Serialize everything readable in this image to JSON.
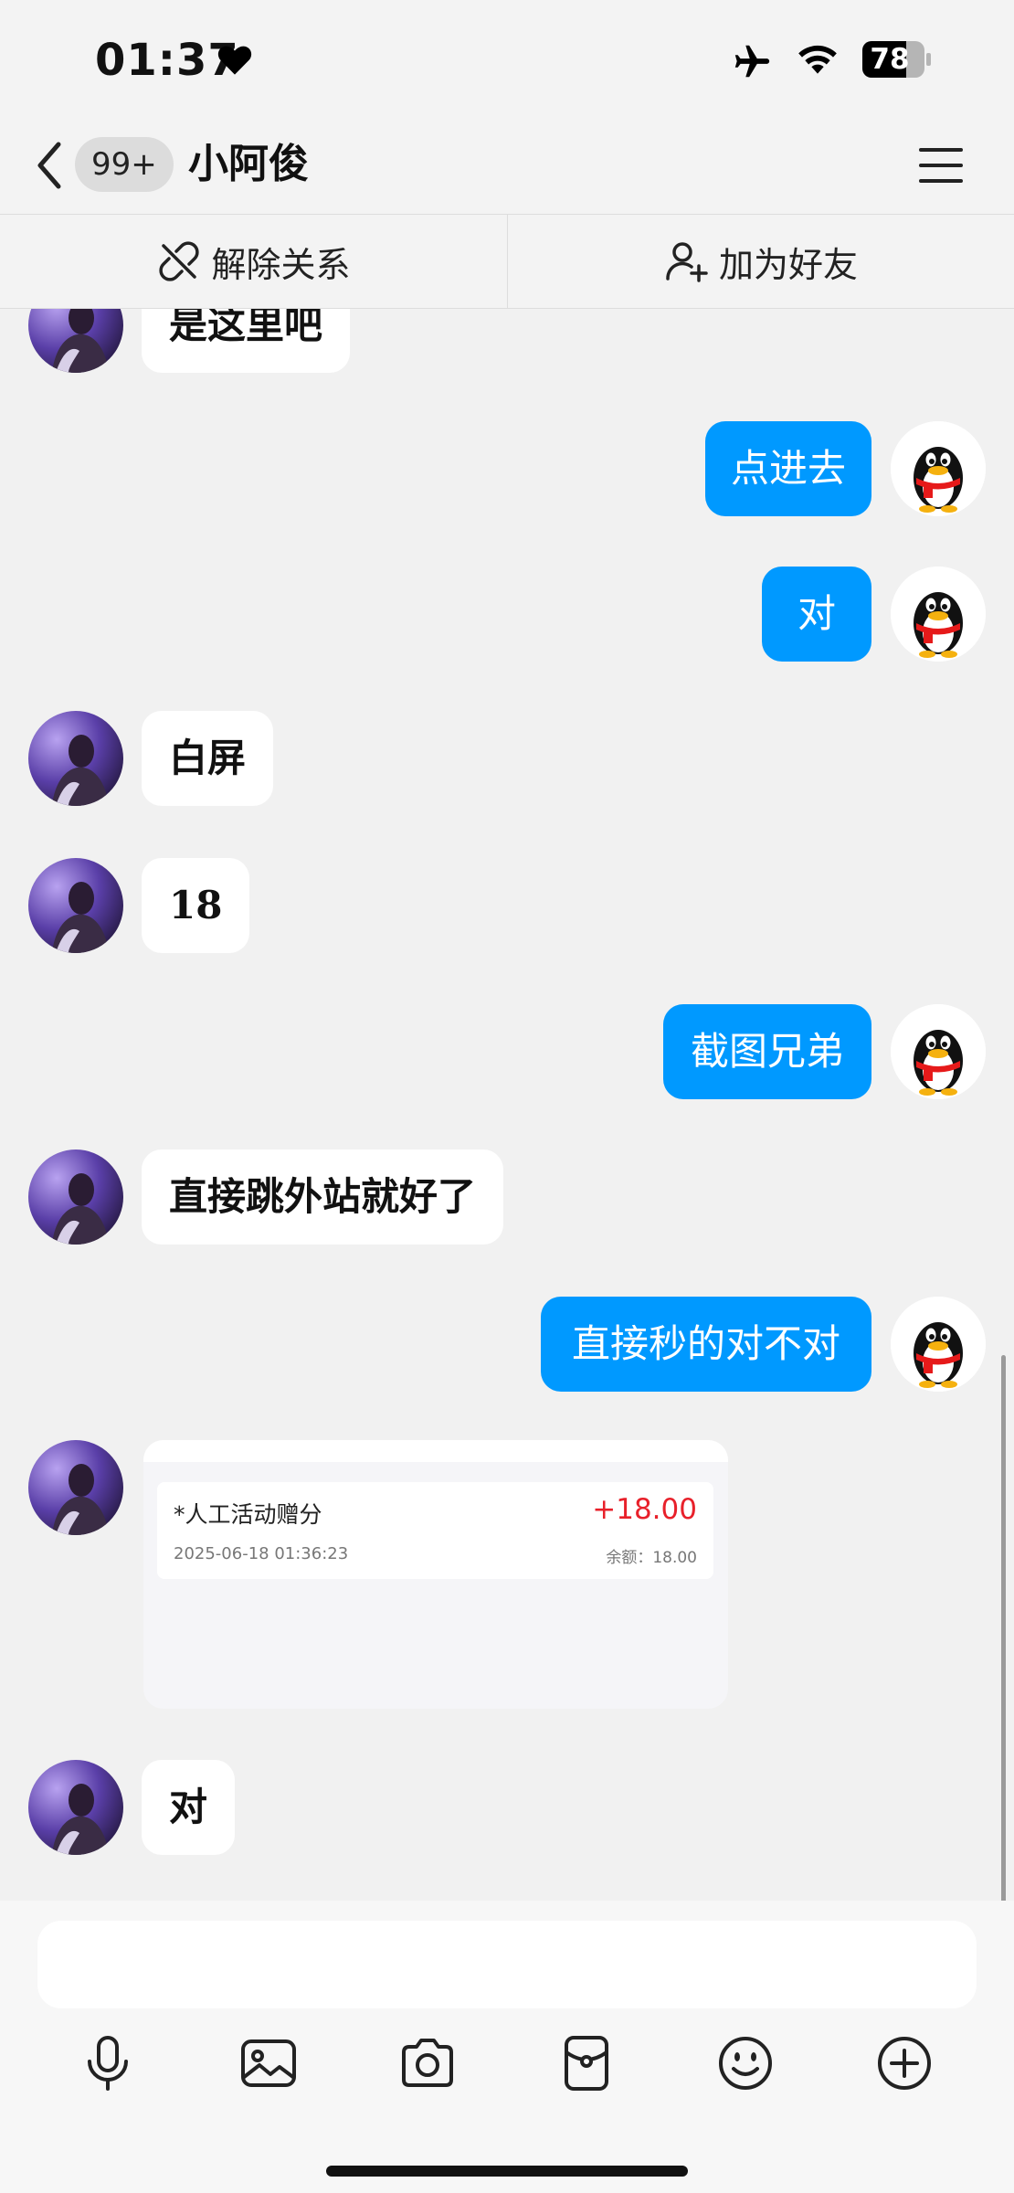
{
  "status_bar": {
    "time": "01:37",
    "battery": "78",
    "icons": [
      "heart-icon",
      "airplane-icon",
      "wifi-icon",
      "battery-icon"
    ]
  },
  "nav": {
    "unread_count": "99+",
    "title": "小阿俊",
    "icons": [
      "chevron-left-icon",
      "menu-icon"
    ]
  },
  "actions": {
    "unlink_label": "解除关系",
    "add_friend_label": "加为好友"
  },
  "messages": [
    {
      "side": "in",
      "text": "是这里吧"
    },
    {
      "side": "out",
      "text": "点进去"
    },
    {
      "side": "out",
      "text": "对"
    },
    {
      "side": "in",
      "text": "白屏"
    },
    {
      "side": "in",
      "text": "18"
    },
    {
      "side": "out",
      "text": "截图兄弟"
    },
    {
      "side": "in",
      "text": "直接跳外站就好了"
    },
    {
      "side": "out",
      "text": "直接秒的对不对"
    },
    {
      "side": "in",
      "type": "image"
    },
    {
      "side": "in",
      "text": "对"
    }
  ],
  "screenshot_card": {
    "item_name": "*人工活动赠分",
    "item_date": "2025-06-18 01:36:23",
    "amount": "+18.00",
    "balance": "余额：18.00"
  },
  "input": {
    "placeholder": "",
    "value": ""
  },
  "toolbar": {
    "icons": [
      "microphone-icon",
      "image-icon",
      "camera-icon",
      "red-packet-icon",
      "emoji-icon",
      "plus-icon"
    ]
  },
  "colors": {
    "accent_blue": "#0099ff",
    "amount_red": "#e8202a",
    "background": "#f1f1f1"
  }
}
